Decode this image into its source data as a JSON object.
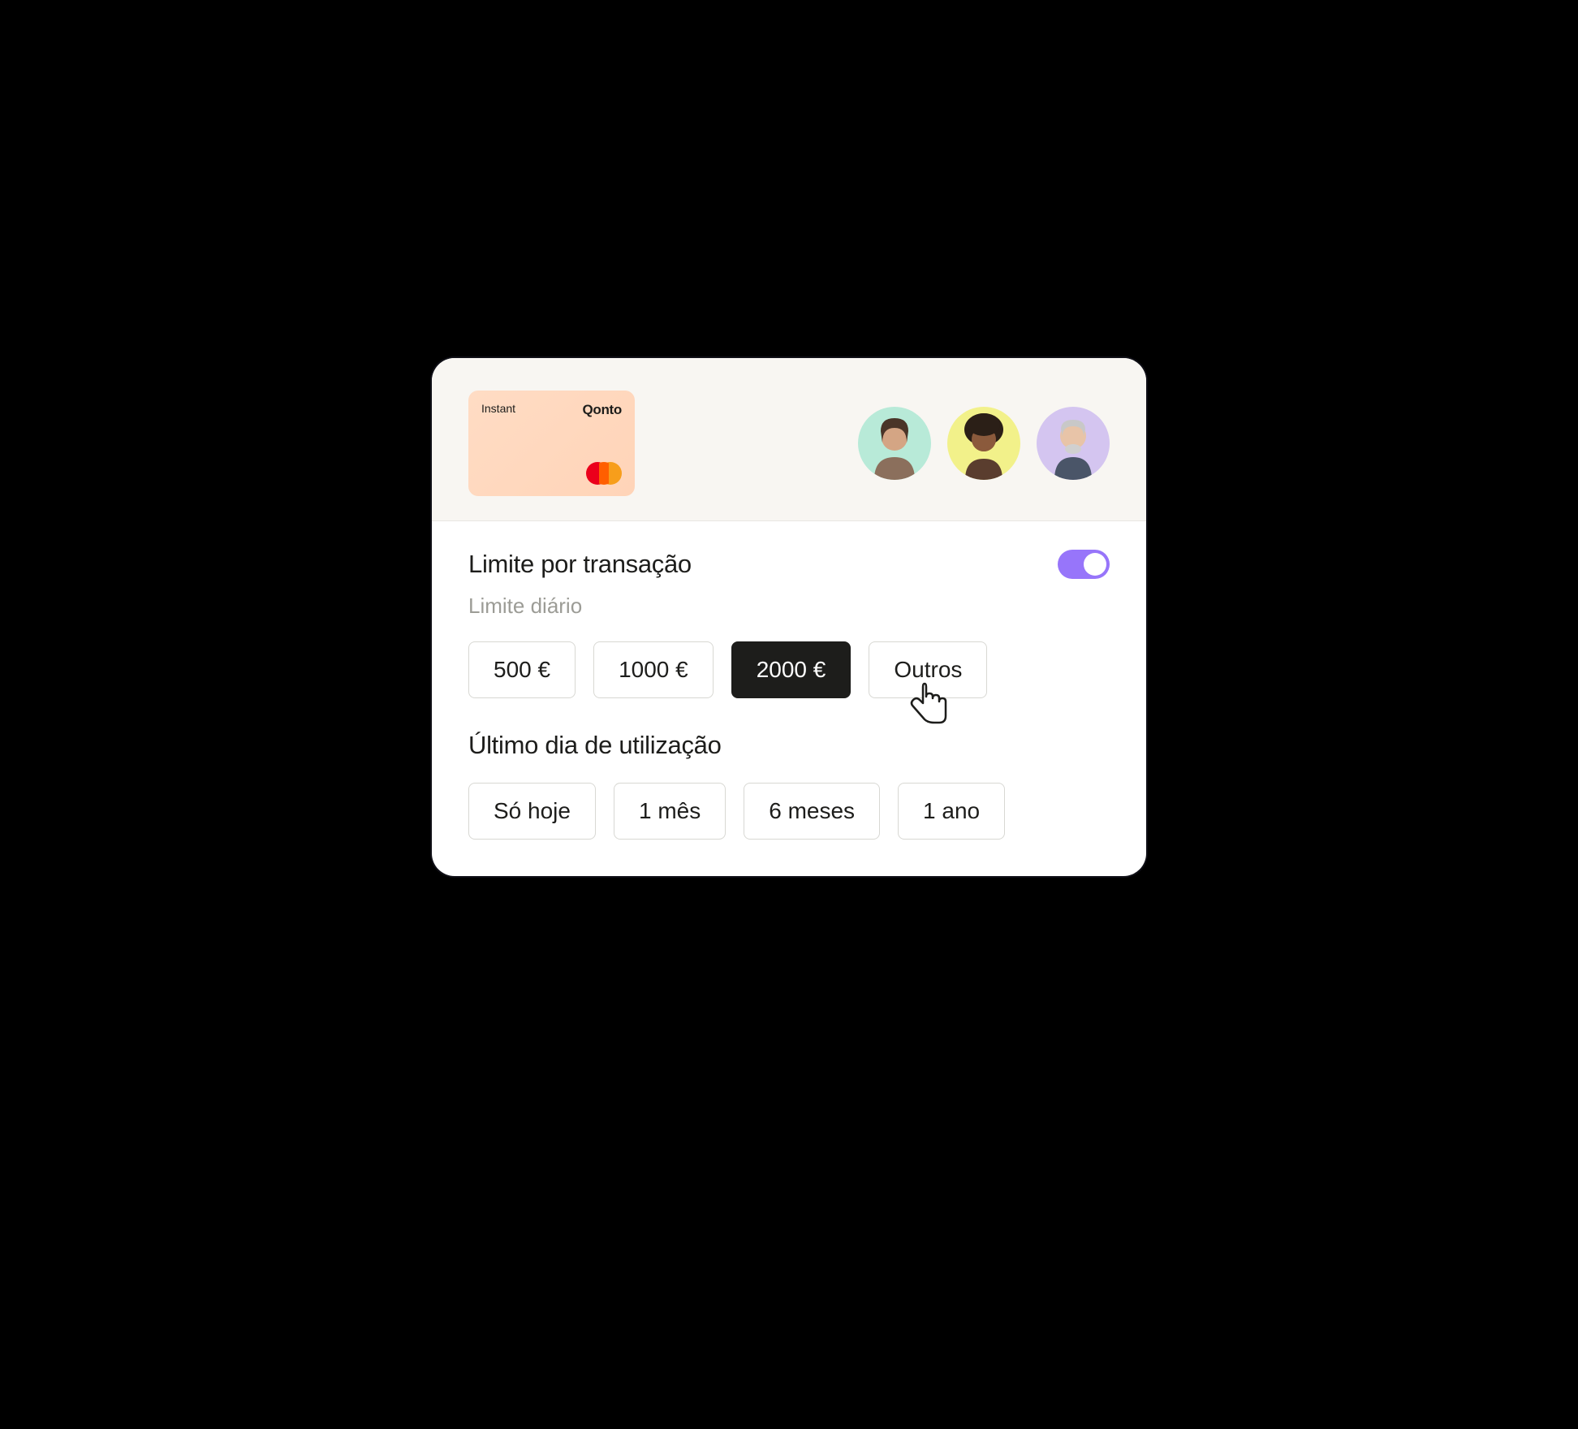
{
  "card": {
    "type": "Instant",
    "brand": "Qonto"
  },
  "transaction_limit": {
    "title": "Limite por transação",
    "enabled": true
  },
  "daily_limit": {
    "label": "Limite diário",
    "options": [
      {
        "label": "500 €",
        "selected": false
      },
      {
        "label": "1000 €",
        "selected": false
      },
      {
        "label": "2000 €",
        "selected": true
      },
      {
        "label": "Outros",
        "selected": false
      }
    ]
  },
  "last_day": {
    "title": "Último dia de utilização",
    "options": [
      {
        "label": "Só hoje"
      },
      {
        "label": "1 mês"
      },
      {
        "label": "6 meses"
      },
      {
        "label": "1 ano"
      }
    ]
  },
  "avatars": [
    {
      "bg": "#b8ead8"
    },
    {
      "bg": "#f2f18a"
    },
    {
      "bg": "#d4c5f0"
    }
  ]
}
